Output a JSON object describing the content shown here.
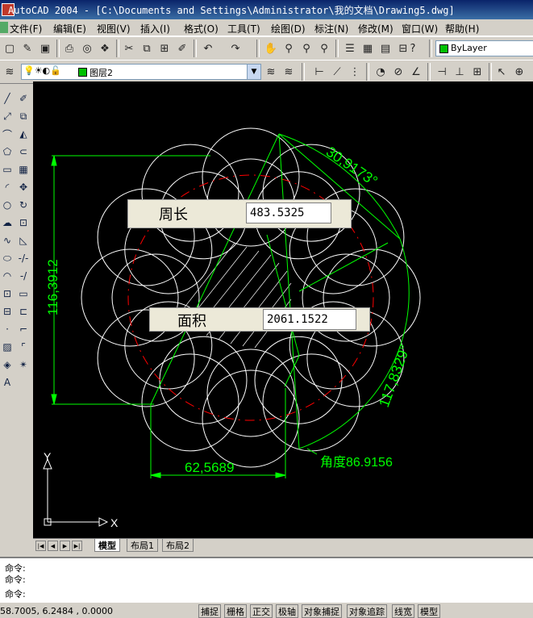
{
  "window": {
    "title": "AutoCAD 2004 - [C:\\Documents and Settings\\Administrator\\我的文档\\Drawing5.dwg]"
  },
  "menu": [
    {
      "label": "文件(F)"
    },
    {
      "label": "编辑(E)"
    },
    {
      "label": "视图(V)"
    },
    {
      "label": "插入(I)"
    },
    {
      "label": "格式(O)"
    },
    {
      "label": "工具(T)"
    },
    {
      "label": "绘图(D)"
    },
    {
      "label": "标注(N)"
    },
    {
      "label": "修改(M)"
    },
    {
      "label": "窗口(W)"
    },
    {
      "label": "帮助(H)"
    }
  ],
  "toolbar": {
    "color_combo": "ByLayer"
  },
  "layers": {
    "current_layer": "图层2"
  },
  "tooltips": {
    "perimeter_label": "周长",
    "perimeter_value": "483.5325",
    "area_label": "面积",
    "area_value": "2061.1522"
  },
  "dimensions": {
    "angle_arc": "30,9173°",
    "vertical": "116,3912",
    "arc_length": "117,8329°",
    "horizontal": "62,5689",
    "angle_label": "角度86.9156"
  },
  "ucs": {
    "x_label": "X",
    "y_label": "Y"
  },
  "tabs": [
    {
      "label": "模型"
    },
    {
      "label": "布局1"
    },
    {
      "label": "布局2"
    }
  ],
  "command": {
    "lines": [
      "命令:",
      "命令:",
      "命令:"
    ]
  },
  "status": {
    "coords": "58.7005, 6.2484 , 0.0000",
    "toggles": [
      {
        "label": "捕捉"
      },
      {
        "label": "栅格"
      },
      {
        "label": "正交"
      },
      {
        "label": "极轴"
      },
      {
        "label": "对象捕捉"
      },
      {
        "label": "对象追踪"
      },
      {
        "label": "线宽"
      },
      {
        "label": "模型"
      }
    ]
  },
  "colors": {
    "canvas": "#000000",
    "drawing": "#ffffff",
    "dimension": "#00ff00",
    "circle": "#ff0000"
  }
}
